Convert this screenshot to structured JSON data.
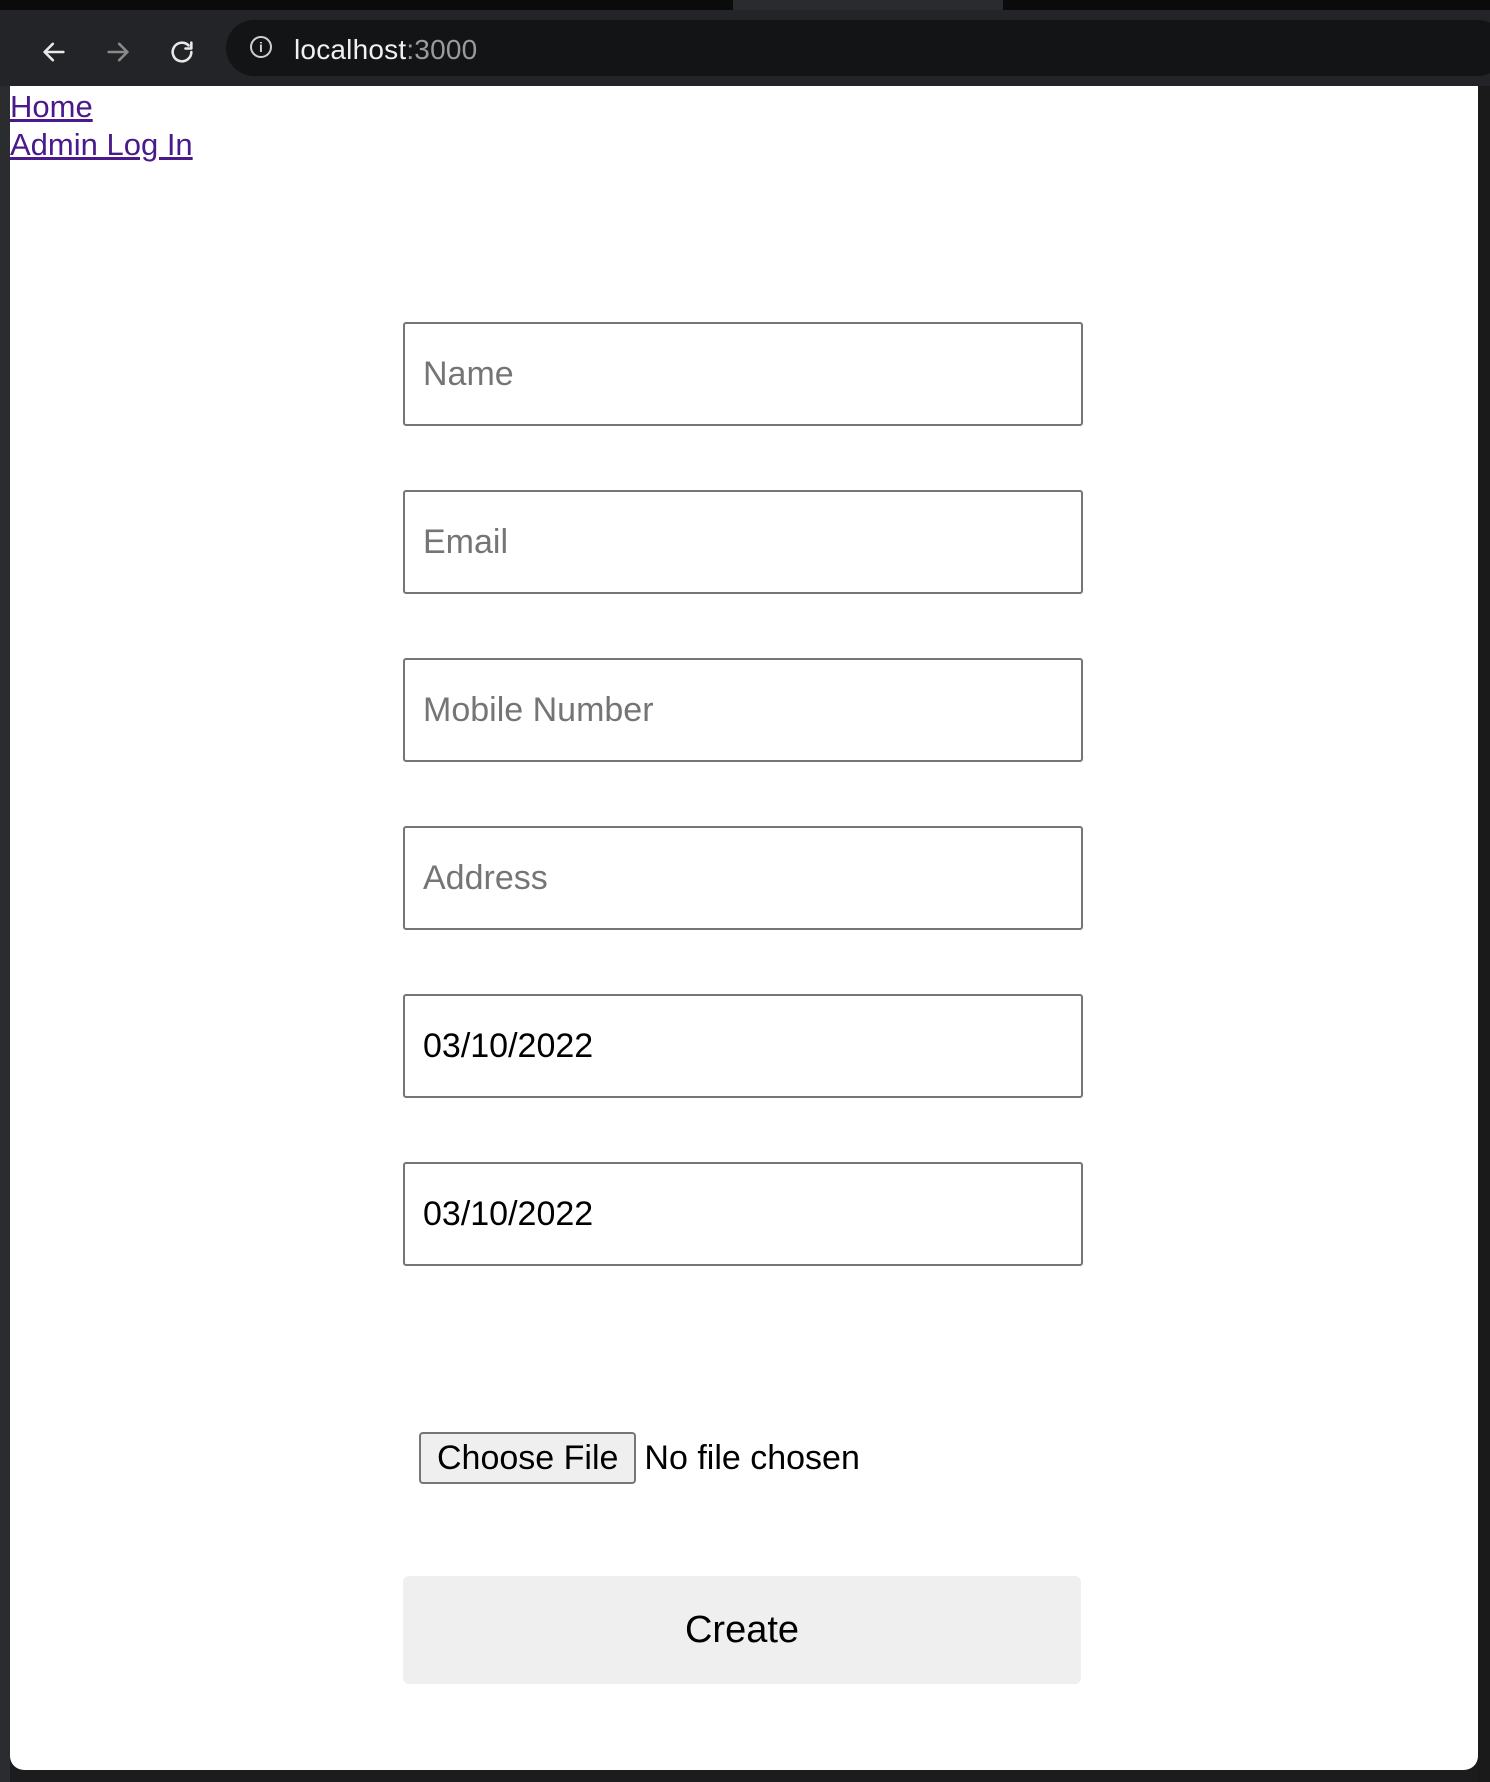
{
  "browser": {
    "url_host": "localhost",
    "url_port": ":3000",
    "back_icon": "arrow-left-icon",
    "forward_icon": "arrow-right-icon",
    "reload_icon": "reload-icon",
    "info_icon": "info-icon"
  },
  "nav": {
    "home": "Home",
    "admin_login": "Admin Log In"
  },
  "form": {
    "name_placeholder": "Name",
    "email_placeholder": "Email",
    "mobile_placeholder": "Mobile Number",
    "address_placeholder": "Address",
    "date1_value": "03/10/2022",
    "date2_value": "03/10/2022",
    "file_button": "Choose File",
    "file_status": "No file chosen",
    "submit_label": "Create"
  }
}
